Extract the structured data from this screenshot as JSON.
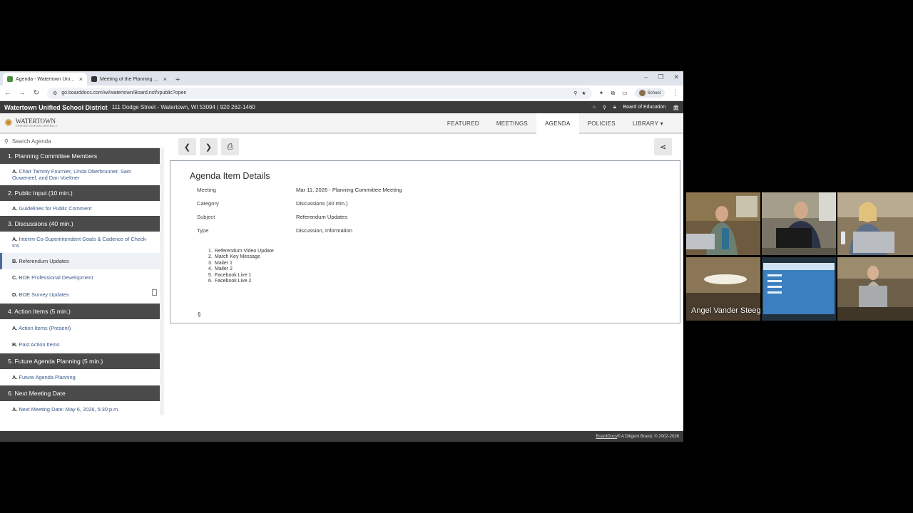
{
  "browser": {
    "tabs": [
      {
        "title": "Agenda - Watertown Unified S...",
        "active": true
      },
      {
        "title": "Meeting of the Planning Comm...",
        "active": false
      }
    ],
    "url": "go.boarddocs.com/wi/watertown/Board.nsf/vpublic?open",
    "profile": "School"
  },
  "site": {
    "district": "Watertown Unified School District",
    "address": "111 Dodge Street - Watertown, WI 53094 | 920 262-1460",
    "board": "Board of Education",
    "logo_text": "WATERTOWN",
    "logo_sub": "UNIFIED SCHOOL DISTRICT",
    "nav": [
      {
        "label": "FEATURED",
        "active": false
      },
      {
        "label": "MEETINGS",
        "active": false
      },
      {
        "label": "AGENDA",
        "active": true
      },
      {
        "label": "POLICIES",
        "active": false
      },
      {
        "label": "LIBRARY",
        "active": false
      }
    ]
  },
  "sidebar": {
    "search_placeholder": "Search Agenda",
    "sections": [
      {
        "title": "1. Planning Committee Members",
        "items": [
          {
            "letter": "A.",
            "text": "Chair Tammy Fournier, Linda Oberbrunner, Sam Ouweneel, and Dan Voeltner"
          }
        ]
      },
      {
        "title": "2. Public Input (10 min.)",
        "items": [
          {
            "letter": "A.",
            "text": "Guidelines for Public Comment"
          }
        ]
      },
      {
        "title": "3. Discussions (40 min.)",
        "items": [
          {
            "letter": "A.",
            "text": "Interim Co-Superintendent Goals & Cadence of Check-Ins"
          },
          {
            "letter": "B.",
            "text": "Referendum Updates",
            "selected": true
          },
          {
            "letter": "C.",
            "text": "BOE Professional Development"
          },
          {
            "letter": "D.",
            "text": "BOE Survey Updates",
            "attachment": true
          }
        ]
      },
      {
        "title": "4. Action Items (5 min.)",
        "items": [
          {
            "letter": "A.",
            "text": "Action Items (Present)"
          },
          {
            "letter": "B.",
            "text": "Past Action Items"
          }
        ]
      },
      {
        "title": "5. Future Agenda Planning (5 min.)",
        "items": [
          {
            "letter": "A.",
            "text": "Future Agenda Planning"
          }
        ]
      },
      {
        "title": "6. Next Meeting Date",
        "items": [
          {
            "letter": "A.",
            "text": "Next Meeting Date: May 6, 2026, 5:30 p.m."
          }
        ]
      }
    ]
  },
  "details": {
    "title": "Agenda Item Details",
    "rows": [
      {
        "label": "Meeting",
        "value": "Mar 11, 2026 - Planning Committee Meeting"
      },
      {
        "label": "Category",
        "value": "Discussions (40 min.)"
      },
      {
        "label": "Subject",
        "value": "Referendum Updates"
      },
      {
        "label": "Type",
        "value": "Discussion, Information"
      }
    ],
    "list": [
      "Referendum Video Update",
      "March Key Message",
      "Mailer 1",
      "Mailer 2",
      "Facebook Live 1",
      "Facebook Live 2"
    ],
    "section_mark": "§"
  },
  "footer": {
    "link": "BoardDocs",
    "text": "® A Diligent Brand, © 2002-2026"
  },
  "video": {
    "speaker": "Angel Vander Steeg"
  }
}
